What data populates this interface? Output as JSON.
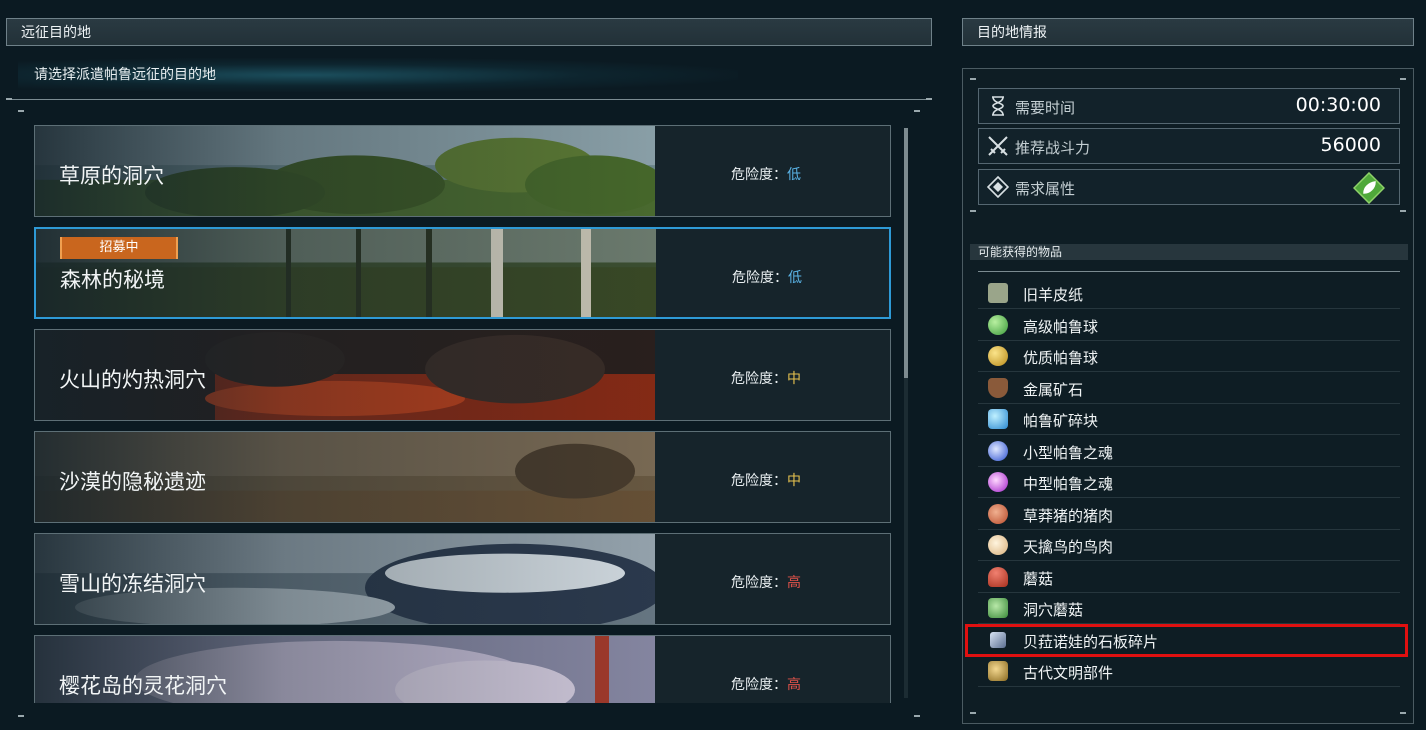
{
  "left_panel": {
    "title": "远征目的地",
    "subtitle": "请选择派遣帕鲁远征的目的地",
    "danger_label": "危险度：",
    "recruit_badge": "招募中",
    "destinations": [
      {
        "name": "草原的洞穴",
        "danger": "低",
        "danger_color": "#5ab3e6"
      },
      {
        "name": "森林的秘境",
        "danger": "低",
        "danger_color": "#5ab3e6",
        "recruiting": true,
        "selected": true
      },
      {
        "name": "火山的灼热洞穴",
        "danger": "中",
        "danger_color": "#e6c24f"
      },
      {
        "name": "沙漠的隐秘遗迹",
        "danger": "中",
        "danger_color": "#e6c24f"
      },
      {
        "name": "雪山的冻结洞穴",
        "danger": "高",
        "danger_color": "#e0524a"
      },
      {
        "name": "樱花岛的灵花洞穴",
        "danger": "高",
        "danger_color": "#e0524a"
      }
    ]
  },
  "right_panel": {
    "title": "目的地情报",
    "info": {
      "time_label": "需要时间",
      "time_value": "00:30:00",
      "power_label": "推荐战斗力",
      "power_value": "56000",
      "element_label": "需求属性",
      "element_icon": "leaf-icon"
    },
    "items_header": "可能获得的物品",
    "items": [
      {
        "label": "旧羊皮纸",
        "icon": "parchment-icon",
        "color": "#9aa58a"
      },
      {
        "label": "高级帕鲁球",
        "icon": "mega-sphere-icon",
        "color": "#5cb85c"
      },
      {
        "label": "优质帕鲁球",
        "icon": "giga-sphere-icon",
        "color": "#d8b030"
      },
      {
        "label": "金属矿石",
        "icon": "ore-icon",
        "color": "#8a5a3a"
      },
      {
        "label": "帕鲁矿碎块",
        "icon": "paldium-icon",
        "color": "#4fb0e8"
      },
      {
        "label": "小型帕鲁之魂",
        "icon": "small-soul-icon",
        "color": "#3d6be0"
      },
      {
        "label": "中型帕鲁之魂",
        "icon": "medium-soul-icon",
        "color": "#c040e0"
      },
      {
        "label": "草莽猪的猪肉",
        "icon": "pork-icon",
        "color": "#d0704a"
      },
      {
        "label": "天擒鸟的鸟肉",
        "icon": "chicken-icon",
        "color": "#e8d6b0"
      },
      {
        "label": "蘑菇",
        "icon": "mushroom-icon",
        "color": "#c84a3a"
      },
      {
        "label": "洞穴蘑菇",
        "icon": "cave-mushroom-icon",
        "color": "#6fb060"
      },
      {
        "label": "贝菈诺娃的石板碎片",
        "icon": "slab-icon",
        "color": "#8aa0c0"
      },
      {
        "label": "古代文明部件",
        "icon": "ancient-part-icon",
        "color": "#c8a050"
      }
    ],
    "highlighted_item": "贝菈诺娃的石板碎片"
  }
}
